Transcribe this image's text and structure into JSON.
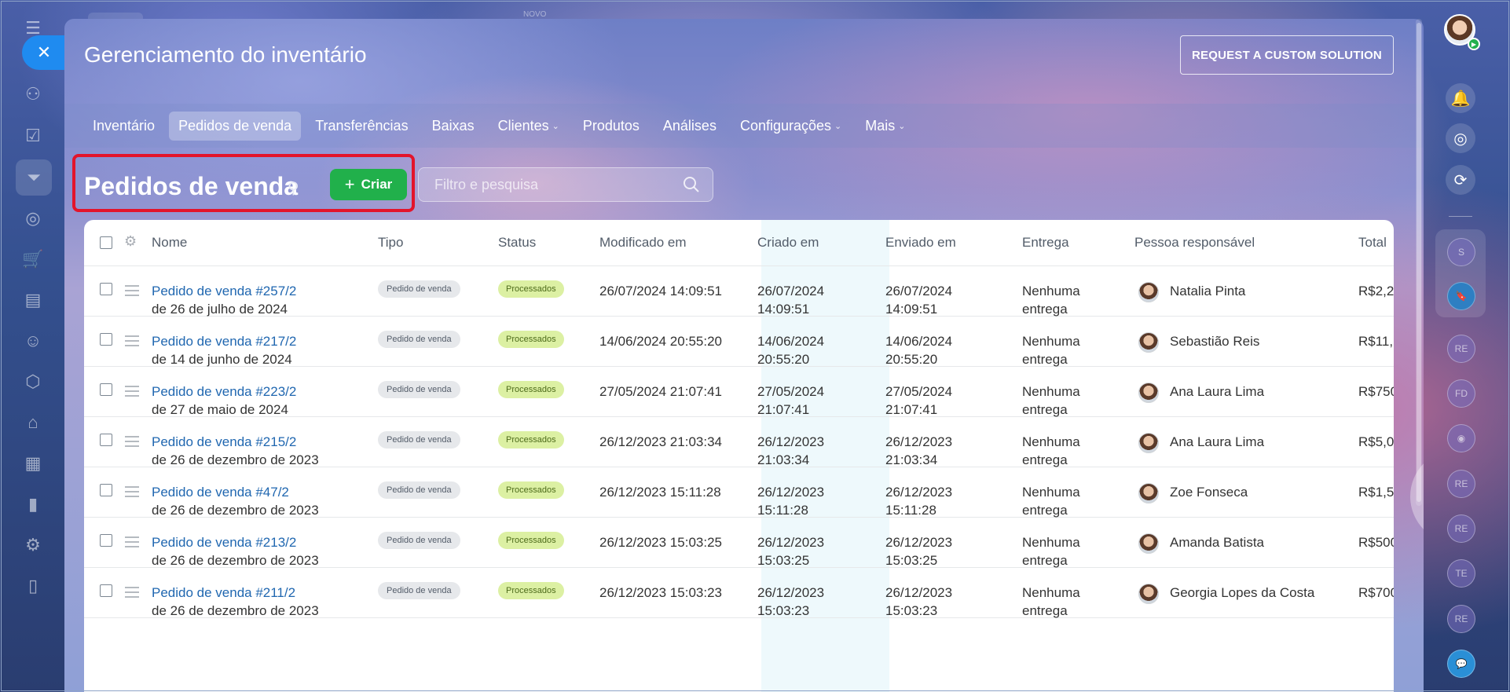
{
  "colors": {
    "link": "#2067b0",
    "create_button": "#21b04b",
    "status_tag_bg": "#dcf0a3",
    "highlight_border": "#e3142b",
    "close_button": "#1f8bf0"
  },
  "topbar": {
    "novo_label": "NOVO"
  },
  "header": {
    "title": "Gerenciamento do inventário",
    "request_button": "REQUEST A CUSTOM SOLUTION"
  },
  "nav": {
    "items": [
      {
        "label": "Inventário",
        "active": false,
        "dropdown": false
      },
      {
        "label": "Pedidos de venda",
        "active": true,
        "dropdown": false
      },
      {
        "label": "Transferências",
        "active": false,
        "dropdown": false
      },
      {
        "label": "Baixas",
        "active": false,
        "dropdown": false
      },
      {
        "label": "Clientes",
        "active": false,
        "dropdown": true
      },
      {
        "label": "Produtos",
        "active": false,
        "dropdown": false
      },
      {
        "label": "Análises",
        "active": false,
        "dropdown": false
      },
      {
        "label": "Configurações",
        "active": false,
        "dropdown": true
      },
      {
        "label": "Mais",
        "active": false,
        "dropdown": true
      }
    ]
  },
  "toolbar": {
    "section_title": "Pedidos de venda",
    "create_label": "Criar",
    "search_placeholder": "Filtro e pesquisa"
  },
  "table": {
    "columns": {
      "name": "Nome",
      "type": "Tipo",
      "status": "Status",
      "modified": "Modificado em",
      "created": "Criado em",
      "sent": "Enviado em",
      "delivery": "Entrega",
      "responsible": "Pessoa responsável",
      "total": "Total"
    },
    "rows": [
      {
        "order": "Pedido de venda #257/2",
        "date_text": "de 26 de julho de 2024",
        "type": "Pedido de venda",
        "status": "Processados",
        "modified": "26/07/2024 14:09:51",
        "created_date": "26/07/2024",
        "created_time": "14:09:51",
        "sent_date": "26/07/2024",
        "sent_time": "14:09:51",
        "delivery_1": "Nenhuma",
        "delivery_2": "entrega",
        "person": "Natalia Pinta",
        "total": "R$2,2"
      },
      {
        "order": "Pedido de venda #217/2",
        "date_text": "de 14 de junho de 2024",
        "type": "Pedido de venda",
        "status": "Processados",
        "modified": "14/06/2024 20:55:20",
        "created_date": "14/06/2024",
        "created_time": "20:55:20",
        "sent_date": "14/06/2024",
        "sent_time": "20:55:20",
        "delivery_1": "Nenhuma",
        "delivery_2": "entrega",
        "person": "Sebastião Reis",
        "total": "R$11,"
      },
      {
        "order": "Pedido de venda #223/2",
        "date_text": "de 27 de maio de 2024",
        "type": "Pedido de venda",
        "status": "Processados",
        "modified": "27/05/2024 21:07:41",
        "created_date": "27/05/2024",
        "created_time": "21:07:41",
        "sent_date": "27/05/2024",
        "sent_time": "21:07:41",
        "delivery_1": "Nenhuma",
        "delivery_2": "entrega",
        "person": "Ana Laura Lima",
        "total": "R$750"
      },
      {
        "order": "Pedido de venda #215/2",
        "date_text": "de 26 de dezembro de 2023",
        "type": "Pedido de venda",
        "status": "Processados",
        "modified": "26/12/2023 21:03:34",
        "created_date": "26/12/2023",
        "created_time": "21:03:34",
        "sent_date": "26/12/2023",
        "sent_time": "21:03:34",
        "delivery_1": "Nenhuma",
        "delivery_2": "entrega",
        "person": "Ana Laura Lima",
        "total": "R$5,0"
      },
      {
        "order": "Pedido de venda #47/2",
        "date_text": "de 26 de dezembro de 2023",
        "type": "Pedido de venda",
        "status": "Processados",
        "modified": "26/12/2023 15:11:28",
        "created_date": "26/12/2023",
        "created_time": "15:11:28",
        "sent_date": "26/12/2023",
        "sent_time": "15:11:28",
        "delivery_1": "Nenhuma",
        "delivery_2": "entrega",
        "person": "Zoe Fonseca",
        "total": "R$1,5"
      },
      {
        "order": "Pedido de venda #213/2",
        "date_text": "de 26 de dezembro de 2023",
        "type": "Pedido de venda",
        "status": "Processados",
        "modified": "26/12/2023 15:03:25",
        "created_date": "26/12/2023",
        "created_time": "15:03:25",
        "sent_date": "26/12/2023",
        "sent_time": "15:03:25",
        "delivery_1": "Nenhuma",
        "delivery_2": "entrega",
        "person": "Amanda Batista",
        "total": "R$500"
      },
      {
        "order": "Pedido de venda #211/2",
        "date_text": "de 26 de dezembro de 2023",
        "type": "Pedido de venda",
        "status": "Processados",
        "modified": "26/12/2023 15:03:23",
        "created_date": "26/12/2023",
        "created_time": "15:03:23",
        "sent_date": "26/12/2023",
        "sent_time": "15:03:23",
        "delivery_1": "Nenhuma",
        "delivery_2": "entrega",
        "person": "Georgia Lopes da Costa",
        "total": "R$700"
      }
    ]
  },
  "right_rail": {
    "badges": [
      "S",
      "RE",
      "FD",
      "RE",
      "RE",
      "TE",
      "RE"
    ]
  }
}
